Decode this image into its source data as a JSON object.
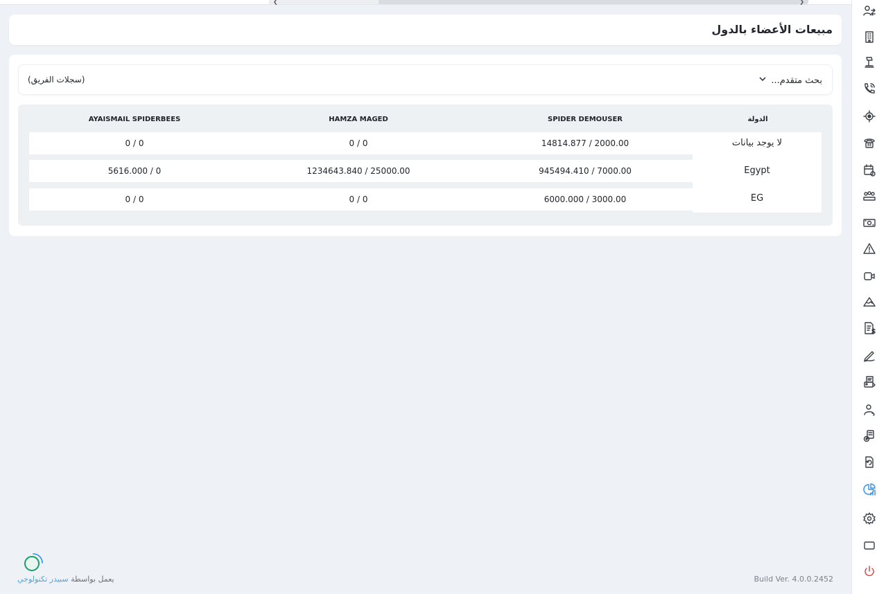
{
  "page": {
    "title": "مبيعات الأعضاء بالدول"
  },
  "filters": {
    "advanced_search_label": "بحث متقدم...",
    "team_records_label": "(سجلات الفريق)"
  },
  "table": {
    "headers": {
      "country": "الدولة",
      "col1": "SPIDER DEMOUSER",
      "col2": "HAMZA MAGED",
      "col3": "AYAISMAIL SPIDERBEES"
    },
    "rows": [
      {
        "country": "لا يوجد بيانات",
        "col1": "14814.877 / 2000.00",
        "col2": "0 / 0",
        "col3": "0 / 0"
      },
      {
        "country": "Egypt",
        "col1": "945494.410 / 7000.00",
        "col2": "1234643.840 / 25000.00",
        "col3": "5616.000 / 0"
      },
      {
        "country": "EG",
        "col1": "6000.000 / 3000.00",
        "col2": "0 / 0",
        "col3": "0 / 0"
      }
    ]
  },
  "footer": {
    "powered_by_prefix": "يعمل بواسطة",
    "powered_by_brand": "سبيدر تكنولوجي",
    "build_version": "Build Ver. 4.0.0.2452"
  },
  "sidebar": {
    "icons": [
      "users-exchange-icon",
      "building-icon",
      "sign-icon",
      "phone-wave-icon",
      "target-icon",
      "telephone-icon",
      "calendar-settings-icon",
      "team-icon",
      "cash-icon",
      "warning-icon",
      "video-icon",
      "mountain-icon",
      "invoice-dollar-icon",
      "signature-icon",
      "printer-receipt-icon",
      "user-call-icon",
      "document-add-icon",
      "document-refresh-icon",
      "chart-report-icon",
      "settings-icon",
      "window-icon",
      "power-icon"
    ],
    "active": "chart-report-icon"
  },
  "colors": {
    "accent": "#2f8fe0",
    "power": "#e23b3b",
    "background": "#eef1f5"
  }
}
